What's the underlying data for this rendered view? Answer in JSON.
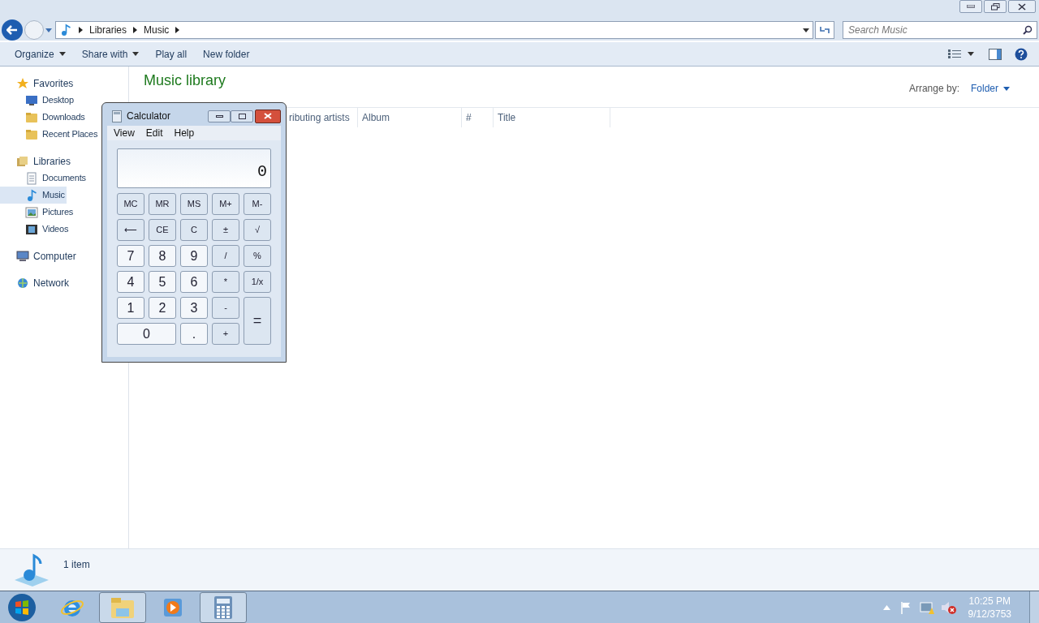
{
  "window": {
    "address": [
      "Libraries",
      "Music"
    ],
    "search": {
      "placeholder": "Search Music"
    }
  },
  "toolbar": [
    {
      "label": "Organize",
      "dropdown": true
    },
    {
      "label": "Share with",
      "dropdown": true
    },
    {
      "label": "Play all",
      "dropdown": false
    },
    {
      "label": "New folder",
      "dropdown": false
    }
  ],
  "nav": [
    {
      "label": "Favorites",
      "selected": false,
      "children": [
        {
          "label": "Desktop",
          "selected": false
        },
        {
          "label": "Downloads",
          "selected": false
        },
        {
          "label": "Recent Places",
          "selected": false
        }
      ]
    },
    {
      "label": "Libraries",
      "selected": false,
      "children": [
        {
          "label": "Documents",
          "selected": false
        },
        {
          "label": "Music",
          "selected": true
        },
        {
          "label": "Pictures",
          "selected": false
        },
        {
          "label": "Videos",
          "selected": false
        }
      ]
    },
    {
      "label": "Computer",
      "selected": false
    },
    {
      "label": "Network",
      "selected": false
    }
  ],
  "content": {
    "title": "Music library",
    "arrange_label": "Arrange by:",
    "arrange_value": "Folder",
    "columns": [
      "ributing artists",
      "Album",
      "#",
      "Title"
    ]
  },
  "status_bar": {
    "text": "1 item"
  },
  "calculator": {
    "title": "Calculator",
    "menu": [
      "View",
      "Edit",
      "Help"
    ],
    "display": "0",
    "buttons": [
      {
        "label": "MC",
        "kind": "normal"
      },
      {
        "label": "MR",
        "kind": "normal"
      },
      {
        "label": "MS",
        "kind": "normal"
      },
      {
        "label": "M+",
        "kind": "normal"
      },
      {
        "label": "M-",
        "kind": "normal"
      },
      {
        "label": "⟵",
        "kind": "normal"
      },
      {
        "label": "CE",
        "kind": "normal"
      },
      {
        "label": "C",
        "kind": "normal"
      },
      {
        "label": "±",
        "kind": "normal"
      },
      {
        "label": "√",
        "kind": "normal"
      },
      {
        "label": "7",
        "kind": "digit"
      },
      {
        "label": "8",
        "kind": "digit"
      },
      {
        "label": "9",
        "kind": "digit"
      },
      {
        "label": "/",
        "kind": "normal"
      },
      {
        "label": "%",
        "kind": "normal"
      },
      {
        "label": "4",
        "kind": "digit"
      },
      {
        "label": "5",
        "kind": "digit"
      },
      {
        "label": "6",
        "kind": "digit"
      },
      {
        "label": "*",
        "kind": "normal"
      },
      {
        "label": "1/x",
        "kind": "normal"
      },
      {
        "label": "1",
        "kind": "digit"
      },
      {
        "label": "2",
        "kind": "digit"
      },
      {
        "label": "3",
        "kind": "digit"
      },
      {
        "label": "-",
        "kind": "normal"
      },
      {
        "label": "=",
        "kind": "tall"
      },
      {
        "label": "0",
        "kind": "wide"
      },
      {
        "label": ".",
        "kind": "digit"
      },
      {
        "label": "+",
        "kind": "normal"
      }
    ]
  },
  "taskbar": {
    "items": [
      {
        "kind": "ie",
        "selected": false
      },
      {
        "kind": "explorer",
        "selected": true
      },
      {
        "kind": "media",
        "selected": false
      },
      {
        "kind": "calculator",
        "selected": true
      }
    ],
    "time": "10:25 PM",
    "date": "9/12/3753"
  }
}
